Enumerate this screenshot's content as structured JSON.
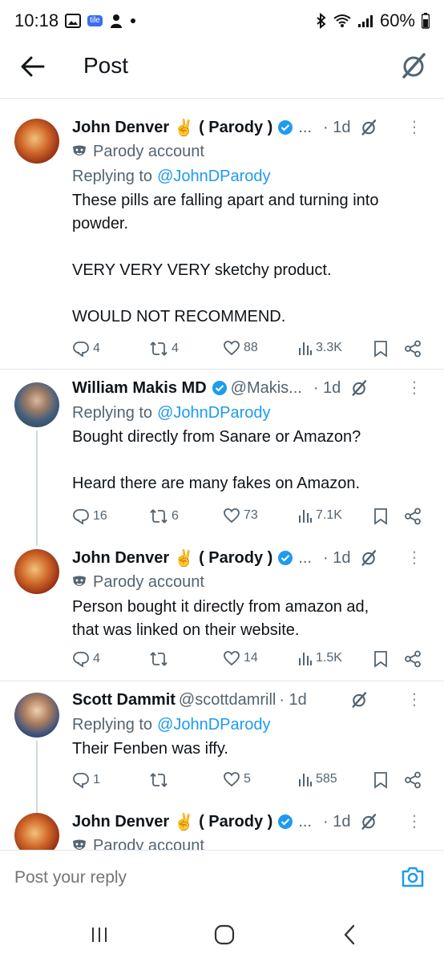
{
  "status_bar": {
    "time": "10:18",
    "tile_label": "tile",
    "battery": "60%",
    "icons": [
      "gallery-icon",
      "tile-icon",
      "person-icon",
      "dot-icon",
      "bluetooth-icon",
      "wifi-icon",
      "signal-icon",
      "battery-icon"
    ]
  },
  "header": {
    "title": "Post",
    "back_icon": "arrow-left-icon",
    "grok_icon": "grok-icon"
  },
  "posts": [
    {
      "name": "John Denver",
      "emoji": "✌️",
      "name_suffix": "( Parody )",
      "handle": "...",
      "time": "· 1d",
      "parody": "Parody account",
      "replying_label": "Replying to",
      "replying_handle": "@JohnDParody",
      "text": [
        "These pills are falling apart and turning into",
        "powder.",
        "",
        "VERY VERY VERY sketchy product.",
        "",
        "WOULD NOT RECOMMEND."
      ],
      "replies": "4",
      "reposts": "4",
      "likes": "88",
      "views": "3.3K"
    },
    {
      "name": "William Makis MD",
      "handle": "@Makis...",
      "time": "· 1d",
      "replying_label": "Replying to",
      "replying_handle": "@JohnDParody",
      "text": [
        "Bought directly from Sanare or Amazon?",
        "",
        "Heard there are many fakes on Amazon."
      ],
      "replies": "16",
      "reposts": "6",
      "likes": "73",
      "views": "7.1K"
    },
    {
      "name": "John Denver",
      "emoji": "✌️",
      "name_suffix": "( Parody )",
      "handle": "...",
      "time": "· 1d",
      "parody": "Parody account",
      "text": [
        "Person bought it directly from amazon ad,",
        "that was linked on their website."
      ],
      "replies": "4",
      "reposts": "",
      "likes": "14",
      "views": "1.5K"
    },
    {
      "name": "Scott Dammit",
      "handle": "@scottdamrill",
      "time": "· 1d",
      "replying_label": "Replying to",
      "replying_handle": "@JohnDParody",
      "text": [
        "Their Fenben was iffy."
      ],
      "replies": "1",
      "reposts": "",
      "likes": "5",
      "views": "585"
    },
    {
      "name": "John Denver",
      "emoji": "✌️",
      "name_suffix": "( Parody )",
      "handle": "...",
      "time": "· 1d",
      "parody": "Parody account"
    }
  ],
  "reply_bar": {
    "placeholder": "Post your reply",
    "camera_icon": "camera-icon"
  },
  "nav_bar": {
    "icons": [
      "recent-apps-icon",
      "home-icon",
      "back-icon"
    ]
  },
  "colors": {
    "accent": "#1d9bf0",
    "text": "#0f1419",
    "muted": "#536471",
    "divider": "#e1e4e8",
    "thread_line": "#cfd9de"
  }
}
